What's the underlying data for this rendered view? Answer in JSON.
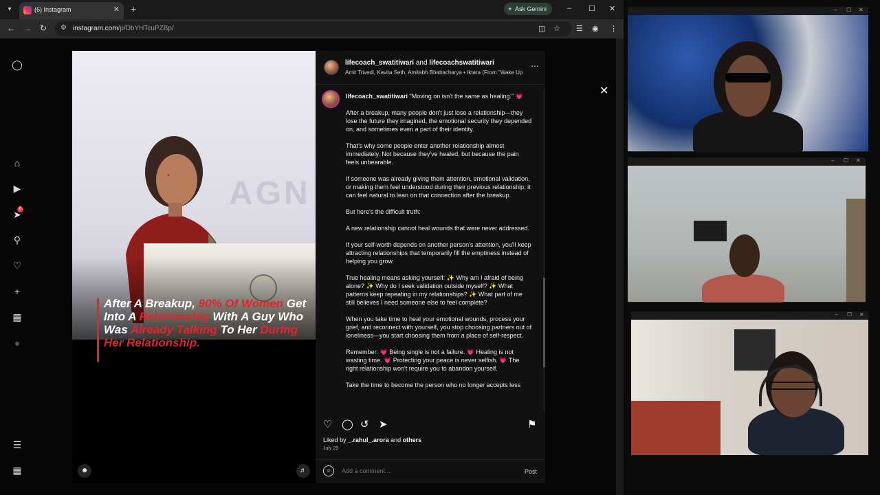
{
  "browser": {
    "tab_title": "(6) Instagram",
    "ask_gemini": "Ask Gemini",
    "url_host": "instagram.com",
    "url_path": "/p/DbYHTcuPZBp/"
  },
  "icons": {
    "back": "back-arrow-icon",
    "forward": "forward-arrow-icon",
    "reload": "reload-icon",
    "site_info": "site-info-icon"
  },
  "sidebar": {
    "notification_badge": "6"
  },
  "slide": {
    "brand_text": "AGN",
    "caption_parts": [
      {
        "text": "After A Breakup, ",
        "red": false
      },
      {
        "text": "90% Of Women",
        "red": true
      },
      {
        "text": " Get Into A ",
        "red": false
      },
      {
        "text": "Relationship",
        "red": true
      },
      {
        "text": " With A Guy Who Was ",
        "red": false
      },
      {
        "text": "Already Talking",
        "red": true
      },
      {
        "text": " To Her ",
        "red": false
      },
      {
        "text": "During Her Relationship.",
        "red": true
      }
    ]
  },
  "post": {
    "author1": "lifecoach_swatitiwari",
    "and": "and",
    "author2": "lifecoachswatitiwari",
    "audio": "Amit Trivedi, Kavita Seth, Amitabh Bhattacharya • Iktara (From \"Wake Up",
    "caption_user": "lifecoach_swatitiwari",
    "caption_body": " \"Moving on isn't the same as healing.\" 💗\n\nAfter a breakup, many people don't just lose a relationship—they lose the future they imagined, the emotional security they depended on, and sometimes even a part of their identity.\n\nThat's why some people enter another relationship almost immediately. Not because they've healed, but because the pain feels unbearable.\n\nIf someone was already giving them attention, emotional validation, or making them feel understood during their previous relationship, it can feel natural to lean on that connection after the breakup.\n\nBut here's the difficult truth:\n\nA new relationship cannot heal wounds that were never addressed.\n\nIf your self-worth depends on another person's attention, you'll keep attracting relationships that temporarily fill the emptiness instead of helping you grow.\n\nTrue healing means asking yourself: ✨ Why am I afraid of being alone? ✨ Why do I seek validation outside myself? ✨ What patterns keep repeating in my relationships? ✨ What part of me still believes I need someone else to feel complete?\n\nWhen you take time to heal your emotional wounds, process your grief, and reconnect with yourself, you stop choosing partners out of loneliness—you start choosing them from a place of self-respect.\n\nRemember: 💗 Being single is not a failure. 💗 Healing is not wasting time. 💗 Protecting your peace is never selfish. 💗 The right relationship won't require you to abandon yourself.\n\nTake the time to become the person who no longer accepts less",
    "liked_by_prefix": "Liked by",
    "liked_by_user": "_.rahul_.arora",
    "liked_by_and": "and",
    "liked_by_others": "others",
    "date": "July 29",
    "comment_placeholder": "Add a comment...",
    "post_label": "Post"
  },
  "colors": {
    "accent_red": "#e1252e",
    "panel_bg": "#111111",
    "badge_red": "#ff3040"
  }
}
